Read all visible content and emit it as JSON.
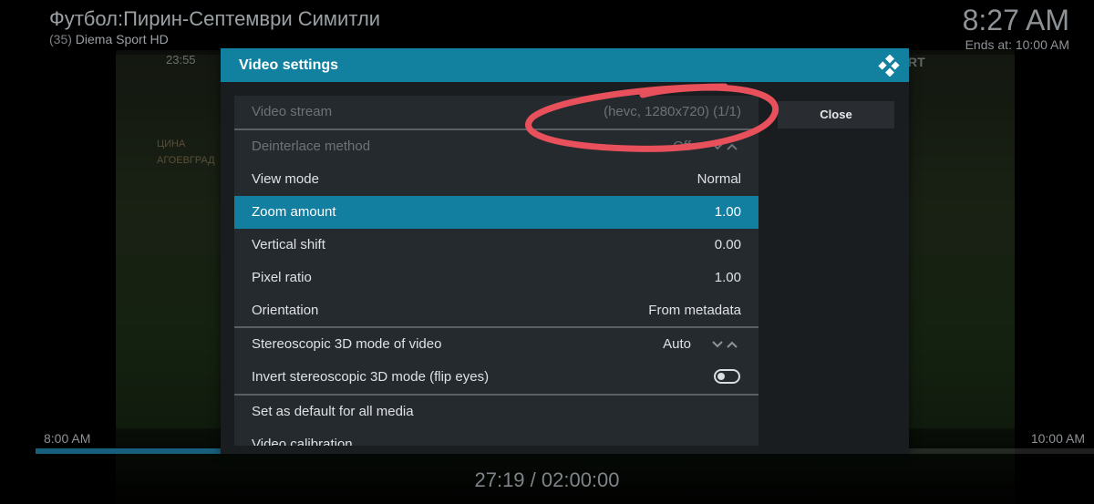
{
  "program": {
    "title": "Футбол:Пирин-Септември Симитли",
    "channel_number": "(35)",
    "channel_name": "Diema Sport HD"
  },
  "clock": {
    "time": "8:27 AM",
    "ends_at": "Ends at: 10:00 AM"
  },
  "video_overlay": {
    "scoreboard": "23:55",
    "brand": "RT",
    "sign": "ЦИНА\nАГОЕВГРАД"
  },
  "timeline": {
    "start": "8:00 AM",
    "end": "10:00 AM",
    "progress_fraction": 0.226,
    "playtime": "27:19 / 02:00:00"
  },
  "dialog": {
    "title": "Video settings",
    "close_label": "Close",
    "items": [
      {
        "label": "Video stream",
        "value": "(hevc, 1280x720) (1/1)"
      },
      {
        "label": "Deinterlace method",
        "value": "Off"
      },
      {
        "label": "View mode",
        "value": "Normal"
      },
      {
        "label": "Zoom amount",
        "value": "1.00"
      },
      {
        "label": "Vertical shift",
        "value": "0.00"
      },
      {
        "label": "Pixel ratio",
        "value": "1.00"
      },
      {
        "label": "Orientation",
        "value": "From metadata"
      },
      {
        "label": "Stereoscopic 3D mode of video",
        "value": "Auto"
      },
      {
        "label": "Invert stereoscopic 3D mode (flip eyes)",
        "value": ""
      },
      {
        "label": "Set as default for all media",
        "value": ""
      },
      {
        "label": "Video calibration",
        "value": ""
      }
    ]
  },
  "colors": {
    "accent": "#12809f",
    "annotation": "#e8505b",
    "text_dim": "#6c7277",
    "panel": "#252a2e"
  },
  "icons": {
    "logo": "kodi-logo-icon",
    "spinner": "chevron-up-down-icon",
    "toggle": "toggle-off-icon"
  }
}
